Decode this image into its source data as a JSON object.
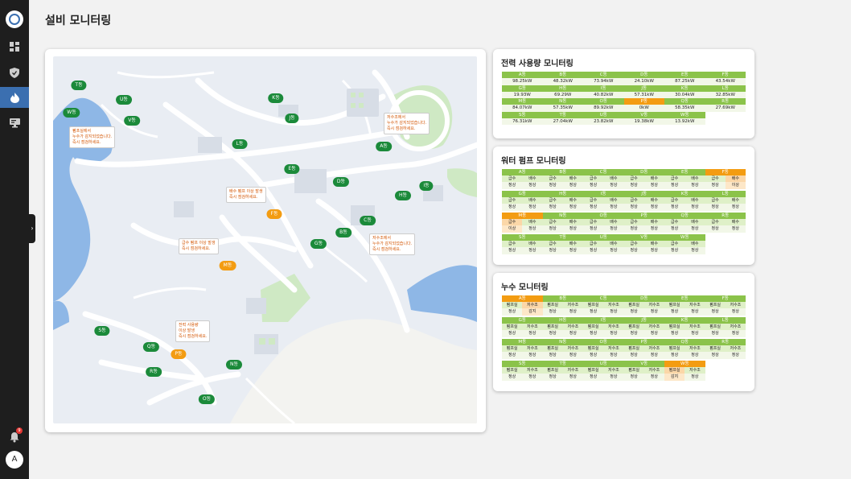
{
  "page": {
    "title": "설비 모니터링"
  },
  "user": {
    "initial": "A",
    "notifications": "9"
  },
  "colors": {
    "ok": "#8bc34a",
    "warn": "#f39c12",
    "marker_ok": "#1b8a3a",
    "sidebar_active": "#3b6fb0"
  },
  "sidebar": {
    "items": [
      {
        "icon": "dashboard-icon"
      },
      {
        "icon": "shield-icon"
      },
      {
        "icon": "flame-icon",
        "active": true
      },
      {
        "icon": "monitor-icon"
      }
    ]
  },
  "map": {
    "markers": [
      {
        "label": "T동"
      },
      {
        "label": "W동"
      },
      {
        "label": "U동"
      },
      {
        "label": "V동"
      },
      {
        "label": "K동"
      },
      {
        "label": "J동"
      },
      {
        "label": "L동"
      },
      {
        "label": "A동"
      },
      {
        "label": "E동"
      },
      {
        "label": "D동"
      },
      {
        "label": "I동"
      },
      {
        "label": "H동"
      },
      {
        "label": "F동"
      },
      {
        "label": "C동"
      },
      {
        "label": "B동"
      },
      {
        "label": "G동"
      },
      {
        "label": "M동"
      },
      {
        "label": "S동"
      },
      {
        "label": "Q동"
      },
      {
        "label": "P동"
      },
      {
        "label": "R동"
      },
      {
        "label": "N동"
      },
      {
        "label": "O동"
      }
    ],
    "callouts": [
      {
        "lines": [
          "펌프실에서",
          "누수가 감지되었습니다.",
          "즉시 점검하세요."
        ]
      },
      {
        "lines": [
          "저수조에서",
          "누수가 감지되었습니다.",
          "즉시 점검하세요."
        ]
      },
      {
        "lines": [
          "배수 펌프 이상 발생",
          "즉시 점검하세요."
        ]
      },
      {
        "lines": [
          "급수 펌프 이상 발생",
          "즉시 점검하세요."
        ]
      },
      {
        "lines": [
          "저수조에서",
          "누수가 감지되었습니다.",
          "즉시 점검하세요."
        ]
      },
      {
        "lines": [
          "전력 사용량",
          "이상 발생",
          "즉시 점검하세요."
        ]
      }
    ]
  },
  "power": {
    "title": "전력 사용량 모니터링",
    "items": [
      {
        "name": "A동",
        "value": "98.25kW"
      },
      {
        "name": "B동",
        "value": "48.32kW"
      },
      {
        "name": "C동",
        "value": "73.94kW"
      },
      {
        "name": "D동",
        "value": "24.10kW"
      },
      {
        "name": "E동",
        "value": "87.25kW"
      },
      {
        "name": "F동",
        "value": "43.54kW"
      },
      {
        "name": "G동",
        "value": "19.93W"
      },
      {
        "name": "H동",
        "value": "69.29W"
      },
      {
        "name": "I동",
        "value": "40.82kW"
      },
      {
        "name": "J동",
        "value": "57.31kW"
      },
      {
        "name": "K동",
        "value": "30.04kW"
      },
      {
        "name": "L동",
        "value": "32.85kW"
      },
      {
        "name": "M동",
        "value": "84.07kW"
      },
      {
        "name": "N동",
        "value": "57.35kW"
      },
      {
        "name": "O동",
        "value": "89.92kW"
      },
      {
        "name": "P동",
        "value": "0kW",
        "warn": true
      },
      {
        "name": "Q동",
        "value": "58.35kW"
      },
      {
        "name": "R동",
        "value": "27.69kW"
      },
      {
        "name": "S동",
        "value": "76.31kW"
      },
      {
        "name": "T동",
        "value": "27.04kW"
      },
      {
        "name": "U동",
        "value": "23.82kW"
      },
      {
        "name": "V동",
        "value": "19.38kW"
      },
      {
        "name": "W동",
        "value": "13.92kW"
      }
    ]
  },
  "pump": {
    "title": "워터 펌프 모니터링",
    "col1": "급수",
    "col2": "배수",
    "items": [
      {
        "name": "A동",
        "v1": "정상",
        "v2": "정상"
      },
      {
        "name": "B동",
        "v1": "정상",
        "v2": "정상"
      },
      {
        "name": "C동",
        "v1": "정상",
        "v2": "정상"
      },
      {
        "name": "D동",
        "v1": "정상",
        "v2": "정상"
      },
      {
        "name": "E동",
        "v1": "정상",
        "v2": "정상"
      },
      {
        "name": "F동",
        "v1": "정상",
        "v2": "이상",
        "warn": true,
        "warn_col": 2
      },
      {
        "name": "G동",
        "v1": "정상",
        "v2": "정상"
      },
      {
        "name": "H동",
        "v1": "정상",
        "v2": "정상"
      },
      {
        "name": "I동",
        "v1": "정상",
        "v2": "정상"
      },
      {
        "name": "J동",
        "v1": "정상",
        "v2": "정상"
      },
      {
        "name": "K동",
        "v1": "정상",
        "v2": "정상"
      },
      {
        "name": "L동",
        "v1": "정상",
        "v2": "정상"
      },
      {
        "name": "M동",
        "v1": "이상",
        "v2": "정상",
        "warn": true,
        "warn_col": 1
      },
      {
        "name": "N동",
        "v1": "정상",
        "v2": "정상"
      },
      {
        "name": "O동",
        "v1": "정상",
        "v2": "정상"
      },
      {
        "name": "P동",
        "v1": "정상",
        "v2": "정상"
      },
      {
        "name": "Q동",
        "v1": "정상",
        "v2": "정상"
      },
      {
        "name": "R동",
        "v1": "정상",
        "v2": "정상"
      },
      {
        "name": "S동",
        "v1": "정상",
        "v2": "정상"
      },
      {
        "name": "T동",
        "v1": "정상",
        "v2": "정상"
      },
      {
        "name": "U동",
        "v1": "정상",
        "v2": "정상"
      },
      {
        "name": "V동",
        "v1": "정상",
        "v2": "정상"
      },
      {
        "name": "W동",
        "v1": "정상",
        "v2": "정상"
      }
    ]
  },
  "leak": {
    "title": "누수 모니터링",
    "col1": "펌프실",
    "col2": "저수조",
    "items": [
      {
        "name": "A동",
        "v1": "정상",
        "v2": "감지",
        "warn": true,
        "warn_col": 2
      },
      {
        "name": "B동",
        "v1": "정상",
        "v2": "정상"
      },
      {
        "name": "C동",
        "v1": "정상",
        "v2": "정상"
      },
      {
        "name": "D동",
        "v1": "정상",
        "v2": "정상"
      },
      {
        "name": "E동",
        "v1": "정상",
        "v2": "정상"
      },
      {
        "name": "F동",
        "v1": "정상",
        "v2": "정상"
      },
      {
        "name": "G동",
        "v1": "정상",
        "v2": "정상"
      },
      {
        "name": "H동",
        "v1": "정상",
        "v2": "정상"
      },
      {
        "name": "I동",
        "v1": "정상",
        "v2": "정상"
      },
      {
        "name": "J동",
        "v1": "정상",
        "v2": "정상"
      },
      {
        "name": "K동",
        "v1": "정상",
        "v2": "정상"
      },
      {
        "name": "L동",
        "v1": "정상",
        "v2": "정상"
      },
      {
        "name": "M동",
        "v1": "정상",
        "v2": "정상"
      },
      {
        "name": "N동",
        "v1": "정상",
        "v2": "정상"
      },
      {
        "name": "O동",
        "v1": "정상",
        "v2": "정상"
      },
      {
        "name": "P동",
        "v1": "정상",
        "v2": "정상"
      },
      {
        "name": "Q동",
        "v1": "정상",
        "v2": "정상"
      },
      {
        "name": "R동",
        "v1": "정상",
        "v2": "정상"
      },
      {
        "name": "S동",
        "v1": "정상",
        "v2": "정상"
      },
      {
        "name": "T동",
        "v1": "정상",
        "v2": "정상"
      },
      {
        "name": "U동",
        "v1": "정상",
        "v2": "정상"
      },
      {
        "name": "V동",
        "v1": "정상",
        "v2": "정상"
      },
      {
        "name": "W동",
        "v1": "감지",
        "v2": "정상",
        "warn": true,
        "warn_col": 1
      }
    ]
  }
}
